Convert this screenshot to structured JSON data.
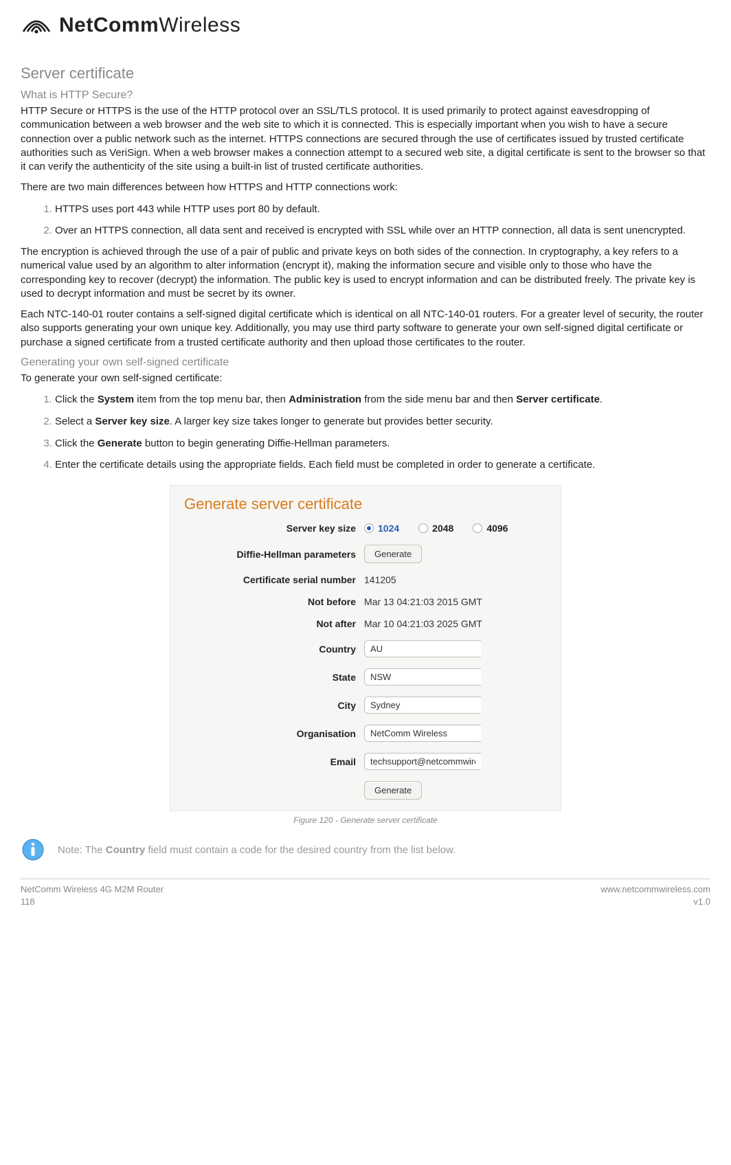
{
  "brand": {
    "bold": "NetComm",
    "light": "Wireless"
  },
  "headings": {
    "title": "Server certificate",
    "sub1": "What is HTTP Secure?",
    "sub2": "Generating your own self-signed certificate"
  },
  "paragraphs": {
    "p1": "HTTP Secure or HTTPS is the use of the HTTP protocol over an SSL/TLS protocol. It is used primarily to protect against eavesdropping of communication between a web browser and the web site to which it is connected. This is especially important when you wish to have a secure connection over a public network such as the internet. HTTPS connections are secured through the use of certificates issued by trusted certificate authorities such as VeriSign. When a web browser makes a connection attempt to a secured web site, a digital certificate is sent to the browser so that it can verify the authenticity of the site using a built-in list of trusted certificate authorities.",
    "p2": "There are two main differences between how HTTPS and HTTP connections work:",
    "p3": "The encryption is achieved through the use of a pair of public and private keys on both sides of the connection. In cryptography, a key refers to a numerical value used by an algorithm to alter information (encrypt it), making the information secure and visible only to those who have the corresponding key to recover (decrypt) the information. The public key is used to encrypt information and can be distributed freely. The private key is used to decrypt information and must be secret by its owner.",
    "p4": "Each NTC-140-01 router contains a self-signed digital certificate which is identical on all NTC-140-01 routers. For a greater level of security, the router also supports generating your own unique key. Additionally, you may use third party software to generate your own self-signed digital certificate or purchase a signed certificate from a trusted certificate authority and then upload those certificates to the router.",
    "p5": "To generate your own self-signed certificate:"
  },
  "list1": {
    "i1": "HTTPS uses port 443 while HTTP uses port 80 by default.",
    "i2": "Over an HTTPS connection, all data sent and received is encrypted with SSL while over an HTTP connection, all data is sent unencrypted."
  },
  "list2": {
    "i1a": "Click the ",
    "i1b": "System",
    "i1c": " item from the top menu bar, then ",
    "i1d": "Administration",
    "i1e": " from the side menu bar and then ",
    "i1f": "Server certificate",
    "i1g": ".",
    "i2a": "Select a ",
    "i2b": "Server key size",
    "i2c": ". A larger key size takes longer to generate but provides better security.",
    "i3a": "Click the ",
    "i3b": "Generate",
    "i3c": " button to begin generating Diffie-Hellman parameters.",
    "i4": "Enter the certificate details using the appropriate fields. Each field must be completed in order to generate a certificate."
  },
  "form": {
    "title": "Generate server certificate",
    "labels": {
      "keysize": "Server key size",
      "dh": "Diffie-Hellman parameters",
      "serial": "Certificate serial number",
      "notbefore": "Not before",
      "notafter": "Not after",
      "country": "Country",
      "state": "State",
      "city": "City",
      "org": "Organisation",
      "email": "Email"
    },
    "keysizes": {
      "o1": "1024",
      "o2": "2048",
      "o3": "4096"
    },
    "buttons": {
      "generate_dh": "Generate",
      "generate_final": "Generate"
    },
    "values": {
      "serial": "141205",
      "notbefore": "Mar 13 04:21:03 2015 GMT",
      "notafter": "Mar 10 04:21:03 2025 GMT",
      "country": "AU",
      "state": "NSW",
      "city": "Sydney",
      "org": "NetComm Wireless",
      "email": "techsupport@netcommwirele"
    }
  },
  "caption": "Figure 120 - Generate server certificate",
  "note": {
    "pre": "Note: The ",
    "bold": "Country",
    "post": " field must contain a code for the desired country from the list below."
  },
  "footer": {
    "product": "NetComm Wireless 4G M2M Router",
    "page": "118",
    "url": "www.netcommwireless.com",
    "version": "v1.0"
  }
}
